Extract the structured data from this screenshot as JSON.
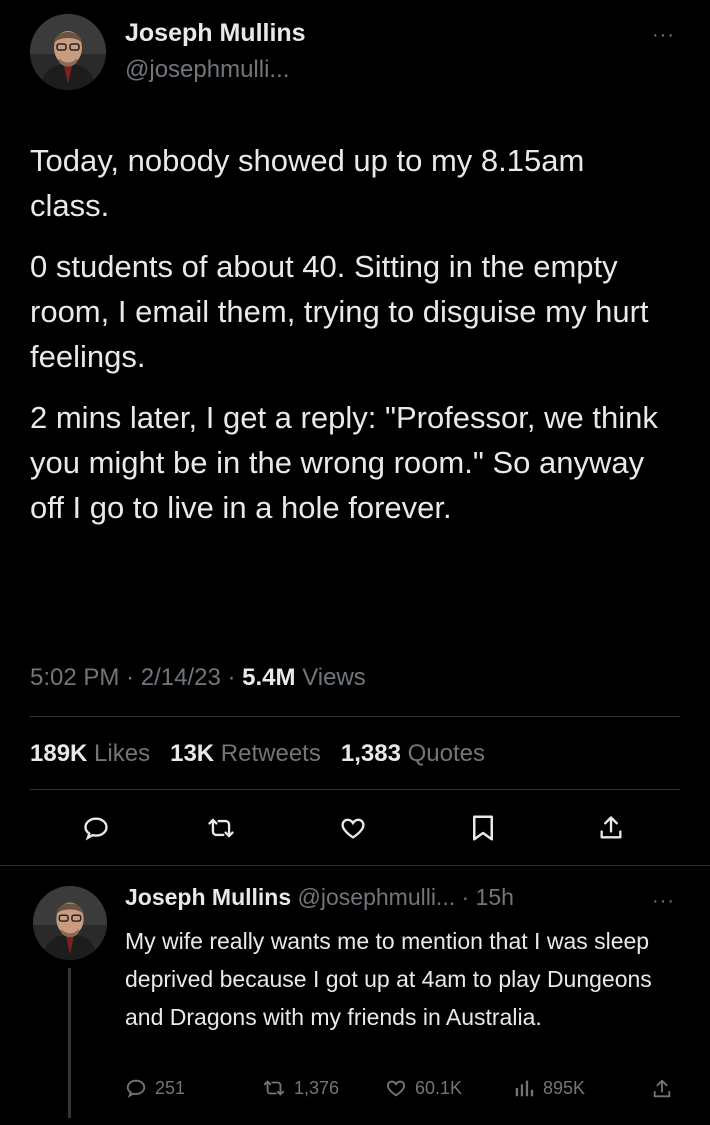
{
  "main_tweet": {
    "author_name": "Joseph Mullins",
    "handle": "@josephmulli...",
    "paragraphs": [
      "Today, nobody showed up to my 8.15am class.",
      "0 students of about 40.  Sitting in the empty room, I email them, trying to disguise my hurt feelings.",
      "2 mins later, I get a reply: \"Professor, we think you might be in the wrong room.\" So anyway off I go to live in a hole forever."
    ],
    "time": "5:02 PM",
    "date": "2/14/23",
    "views_count": "5.4M",
    "views_label": "Views",
    "likes_count": "189K",
    "likes_label": "Likes",
    "retweets_count": "13K",
    "retweets_label": "Retweets",
    "quotes_count": "1,383",
    "quotes_label": "Quotes",
    "separator": "·",
    "more": "···"
  },
  "reply": {
    "author_name": "Joseph Mullins",
    "handle": "@josephmulli...",
    "age": "· 15h",
    "text": "My wife really wants me to mention that I was sleep deprived because I got up at 4am to play Dungeons and Dragons with my friends in Australia.",
    "replies": "251",
    "retweets": "1,376",
    "likes": "60.1K",
    "views": "895K",
    "more": "···"
  },
  "icons": [
    "reply-icon",
    "retweet-icon",
    "like-icon",
    "bookmark-icon",
    "share-icon",
    "views-icon"
  ],
  "colors": {
    "background": "#000000",
    "text": "#e7e9ea",
    "muted": "#71767b",
    "divider": "#2f3336"
  }
}
